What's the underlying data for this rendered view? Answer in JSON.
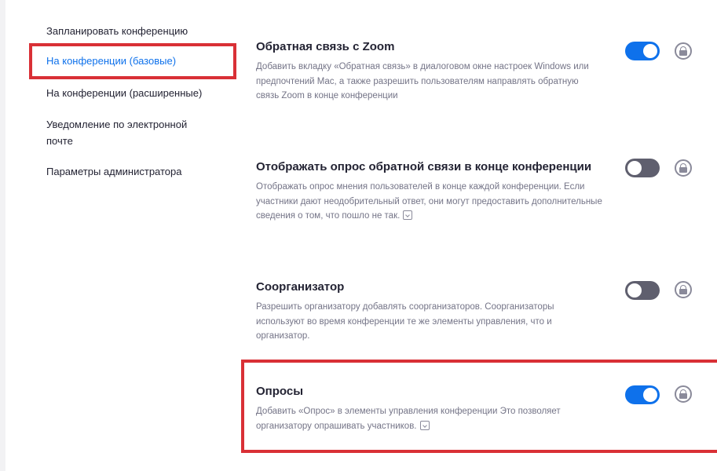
{
  "sidebar": {
    "items": [
      {
        "label": "Запланировать конференцию",
        "active": false
      },
      {
        "label": "На конференции (базовые)",
        "active": true
      },
      {
        "label": "На конференции (расширенные)",
        "active": false
      },
      {
        "label": "Уведомление по электронной почте",
        "active": false
      },
      {
        "label": "Параметры администратора",
        "active": false
      }
    ]
  },
  "settings": [
    {
      "title": "Обратная связь с Zoom",
      "description": "Добавить вкладку «Обратная связь» в диалоговом окне настроек Windows или предпочтений Mac, а также разрешить пользователям направлять обратную связь Zoom в конце конференции",
      "enabled": true,
      "has_info_icon": false
    },
    {
      "title": "Отображать опрос обратной связи в конце конференции",
      "description": "Отображать опрос мнения пользователей в конце каждой конференции. Если участники дают неодобрительный ответ, они могут предоставить дополнительные сведения о том, что пошло не так.",
      "enabled": false,
      "has_info_icon": true
    },
    {
      "title": "Соорганизатор",
      "description": "Разрешить организатору добавлять соорганизаторов. Соорганизаторы используют во время конференции те же элементы управления, что и организатор.",
      "enabled": false,
      "has_info_icon": false
    },
    {
      "title": "Опросы",
      "description": "Добавить «Опрос» в элементы управления конференции Это позволяет организатору опрашивать участников.",
      "enabled": true,
      "has_info_icon": true
    }
  ],
  "colors": {
    "accent": "#0e71eb",
    "highlight": "#d93036",
    "toggle_off": "#5f5f6e",
    "title_text": "#232333",
    "desc_text": "#747487"
  },
  "icons": {
    "lock": "lock-icon",
    "info": "info-icon"
  }
}
